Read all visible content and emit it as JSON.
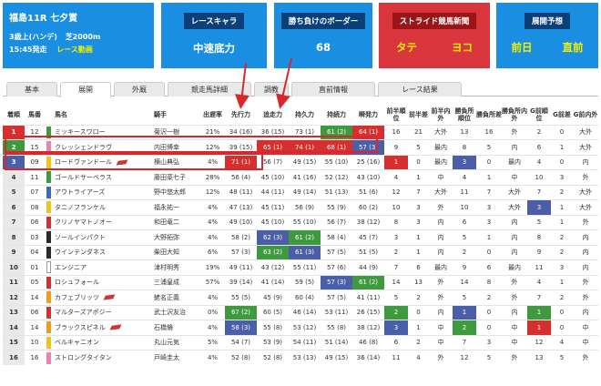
{
  "race": {
    "title": "福島11R 七夕賞",
    "condition": "3歳上(ハンデ)",
    "distance": "芝2000m",
    "time": "15:45発走",
    "video_link": "レース動画"
  },
  "cards": [
    {
      "label": "レースキャラ",
      "value": "中速底力"
    },
    {
      "label": "勝ち負けのボーダー",
      "value": "68"
    },
    {
      "label": "ストライド競馬新聞",
      "left": "タテ",
      "right": "ヨコ"
    },
    {
      "label": "展開予想",
      "left": "前日",
      "right": "直前"
    }
  ],
  "tabs": [
    "基本",
    "展開",
    "外厩",
    "競走馬詳細",
    "調教",
    "直前情報",
    "レース結果"
  ],
  "active_tab": "展開",
  "columns": [
    "着順",
    "馬番",
    "",
    "馬名",
    "騎手",
    "出遅率",
    "先行力",
    "追走力",
    "持久力",
    "持続力",
    "瞬発力",
    "前半順位",
    "前半差",
    "前半内外",
    "勝負所順位",
    "勝負所差",
    "勝負所内外",
    "G前順位",
    "G前差",
    "G前内外"
  ],
  "rows": [
    {
      "rank": "1",
      "num": "12",
      "frame": 6,
      "name": "ミッキースワロー",
      "jockey": "菊沢一樹",
      "late": "21%",
      "senko": "34 (16)",
      "tsuiso": "36 (15)",
      "jikyu": "73 (1)",
      "jizoku": "61 (2)",
      "shunpatsu": "64 (1)",
      "fo": "16",
      "fd": "21",
      "fio": "大外",
      "mo": "13",
      "md": "16",
      "mio": "外",
      "go": "2",
      "gd": "0",
      "gio": "大外",
      "hl": {
        "jizoku": "green",
        "shunpatsu": "red"
      }
    },
    {
      "rank": "2",
      "num": "15",
      "frame": 8,
      "name": "クレッシェンドラヴ",
      "jockey": "内田博幸",
      "late": "12%",
      "senko": "39 (15)",
      "tsuiso": "65 (1)",
      "jikyu": "74 (1)",
      "jizoku": "68 (1)",
      "shunpatsu": "57 (3)",
      "fo": "9",
      "fd": "5",
      "fio": "最内",
      "mo": "8",
      "md": "5",
      "mio": "内",
      "go": "6",
      "gd": "1",
      "gio": "大外",
      "hl": {
        "tsuiso": "red",
        "jikyu": "red",
        "jizoku": "red",
        "shunpatsu": "blue"
      }
    },
    {
      "rank": "3",
      "num": "09",
      "frame": 5,
      "name": "ロードヴァンドール",
      "jockey": "横山典弘",
      "late": "4%",
      "senko": "71 (1)",
      "tsuiso": "56 (7)",
      "jikyu": "49 (15)",
      "jizoku": "55 (10)",
      "shunpatsu": "25 (16)",
      "fo": "1",
      "fd": "0",
      "fio": "最内",
      "mo": "3",
      "md": "0",
      "mio": "最内",
      "go": "4",
      "gd": "0",
      "gio": "内",
      "hl": {
        "senko": "red"
      },
      "marks": {
        "fo": "a",
        "mo": "b"
      },
      "flag": true
    },
    {
      "rank": "4",
      "num": "11",
      "frame": 6,
      "name": "ゴールドサーベラス",
      "jockey": "藤田菜七子",
      "late": "28%",
      "senko": "56 (4)",
      "tsuiso": "45 (10)",
      "jikyu": "41 (16)",
      "jizoku": "52 (12)",
      "shunpatsu": "43 (10)",
      "fo": "4",
      "fd": "1",
      "fio": "中",
      "mo": "4",
      "md": "1",
      "mio": "中",
      "go": "10",
      "gd": "3",
      "gio": "外"
    },
    {
      "rank": "5",
      "num": "07",
      "frame": 4,
      "name": "アウトライアーズ",
      "jockey": "野中悠太郎",
      "late": "12%",
      "senko": "48 (11)",
      "tsuiso": "44 (11)",
      "jikyu": "49 (14)",
      "jizoku": "51 (13)",
      "shunpatsu": "51 (6)",
      "fo": "12",
      "fd": "7",
      "fio": "大外",
      "mo": "11",
      "md": "7",
      "mio": "大外",
      "go": "7",
      "gd": "2",
      "gio": "大外"
    },
    {
      "rank": "6",
      "num": "08",
      "frame": 5,
      "name": "タニノフランケル",
      "jockey": "福永祐一",
      "late": "4%",
      "senko": "47 (13)",
      "tsuiso": "45 (11)",
      "jikyu": "56 (9)",
      "jizoku": "55 (9)",
      "shunpatsu": "60 (2)",
      "fo": "10",
      "fd": "3",
      "fio": "外",
      "mo": "10",
      "md": "3",
      "mio": "大外",
      "go": "3",
      "gd": "1",
      "gio": "大外",
      "marks": {
        "go": "b"
      }
    },
    {
      "rank": "7",
      "num": "06",
      "frame": 3,
      "name": "クリノヤマトノオー",
      "jockey": "和田竜二",
      "late": "4%",
      "senko": "49 (10)",
      "tsuiso": "45 (10)",
      "jikyu": "55 (10)",
      "jizoku": "56 (7)",
      "shunpatsu": "38 (12)",
      "fo": "8",
      "fd": "3",
      "fio": "内",
      "mo": "6",
      "md": "3",
      "mio": "内",
      "go": "5",
      "gd": "1",
      "gio": "外"
    },
    {
      "rank": "8",
      "num": "03",
      "frame": 2,
      "name": "ソールインパクト",
      "jockey": "大野拓弥",
      "late": "4%",
      "senko": "58 (2)",
      "tsuiso": "62 (3)",
      "jikyu": "61 (2)",
      "jizoku": "58 (4)",
      "shunpatsu": "45 (7)",
      "fo": "3",
      "fd": "1",
      "fio": "内",
      "mo": "5",
      "md": "1",
      "mio": "内",
      "go": "8",
      "gd": "2",
      "gio": "内",
      "hl": {
        "tsuiso": "blue",
        "jikyu": "green"
      }
    },
    {
      "rank": "9",
      "num": "04",
      "frame": 2,
      "name": "ウインテンダネス",
      "jockey": "柴田大知",
      "late": "6%",
      "senko": "57 (3)",
      "tsuiso": "63 (2)",
      "jikyu": "61 (3)",
      "jizoku": "57 (5)",
      "shunpatsu": "51 (5)",
      "fo": "2",
      "fd": "1",
      "fio": "内",
      "mo": "2",
      "md": "0",
      "mio": "内",
      "go": "9",
      "gd": "2",
      "gio": "内",
      "hl": {
        "tsuiso": "green",
        "jikyu": "blue"
      }
    },
    {
      "rank": "10",
      "num": "01",
      "frame": 1,
      "name": "エンジニア",
      "jockey": "津村明秀",
      "late": "19%",
      "senko": "49 (11)",
      "tsuiso": "43 (12)",
      "jikyu": "55 (11)",
      "jizoku": "57 (6)",
      "shunpatsu": "44 (9)",
      "fo": "7",
      "fd": "6",
      "fio": "最内",
      "mo": "9",
      "md": "6",
      "mio": "最内",
      "go": "11",
      "gd": "3",
      "gio": "内"
    },
    {
      "rank": "11",
      "num": "05",
      "frame": 3,
      "name": "ロシュフォール",
      "jockey": "三浦皇成",
      "late": "57%",
      "senko": "39 (14)",
      "tsuiso": "41 (14)",
      "jikyu": "59 (5)",
      "jizoku": "57 (3)",
      "shunpatsu": "61 (2)",
      "fo": "14",
      "fd": "13",
      "fio": "外",
      "mo": "14",
      "md": "8",
      "mio": "外",
      "go": "4",
      "gd": "1",
      "gio": "外",
      "hl": {
        "jizoku": "blue",
        "shunpatsu": "green"
      }
    },
    {
      "rank": "12",
      "num": "14",
      "frame": 7,
      "name": "カフェブリッツ",
      "jockey": "蛯名正義",
      "late": "4%",
      "senko": "55 (5)",
      "tsuiso": "45 (9)",
      "jikyu": "60 (4)",
      "jizoku": "57 (5)",
      "shunpatsu": "41 (11)",
      "fo": "5",
      "fd": "2",
      "fio": "外",
      "mo": "5",
      "md": "2",
      "mio": "外",
      "go": "7",
      "gd": "2",
      "gio": "外",
      "flag": true
    },
    {
      "rank": "13",
      "num": "06",
      "frame": 3,
      "name": "マルターズアポジー",
      "jockey": "武士沢友治",
      "late": "0%",
      "senko": "67 (2)",
      "tsuiso": "60 (5)",
      "jikyu": "46 (14)",
      "jizoku": "53 (11)",
      "shunpatsu": "26 (15)",
      "fo": "2",
      "fd": "0",
      "fio": "内",
      "mo": "1",
      "md": "0",
      "mio": "内",
      "go": "1",
      "gd": "0",
      "gio": "内",
      "hl": {
        "senko": "green"
      },
      "marks": {
        "fo": "c",
        "mo": "b",
        "go": "c"
      }
    },
    {
      "rank": "14",
      "num": "14",
      "frame": 7,
      "name": "ブラックスピネル",
      "jockey": "石橋脩",
      "late": "4%",
      "senko": "58 (3)",
      "tsuiso": "55 (8)",
      "jikyu": "53 (12)",
      "jizoku": "55 (8)",
      "shunpatsu": "38 (12)",
      "fo": "3",
      "fd": "1",
      "fio": "中",
      "mo": "2",
      "md": "0",
      "mio": "中",
      "go": "1",
      "gd": "0",
      "gio": "中",
      "hl": {
        "senko": "blue"
      },
      "marks": {
        "fo": "b",
        "mo": "c",
        "go": "a"
      },
      "flag": true
    },
    {
      "rank": "15",
      "num": "10",
      "frame": 5,
      "name": "ベルキャニオン",
      "jockey": "丸山元気",
      "late": "5%",
      "senko": "54 (7)",
      "tsuiso": "53 (9)",
      "jikyu": "54 (11)",
      "jizoku": "51 (14)",
      "shunpatsu": "46 (8)",
      "fo": "6",
      "fd": "2",
      "fio": "中",
      "mo": "7",
      "md": "3",
      "mio": "中",
      "go": "12",
      "gd": "4",
      "gio": "中"
    },
    {
      "rank": "16",
      "num": "16",
      "frame": 8,
      "name": "ストロングタイタン",
      "jockey": "戸崎圭太",
      "late": "4%",
      "senko": "52 (8)",
      "tsuiso": "52 (8)",
      "jikyu": "53 (13)",
      "jizoku": "49 (15)",
      "shunpatsu": "36 (14)",
      "fo": "11",
      "fd": "4",
      "fio": "外",
      "mo": "12",
      "md": "5",
      "mio": "外",
      "go": "13",
      "gd": "5",
      "gio": "外"
    }
  ]
}
